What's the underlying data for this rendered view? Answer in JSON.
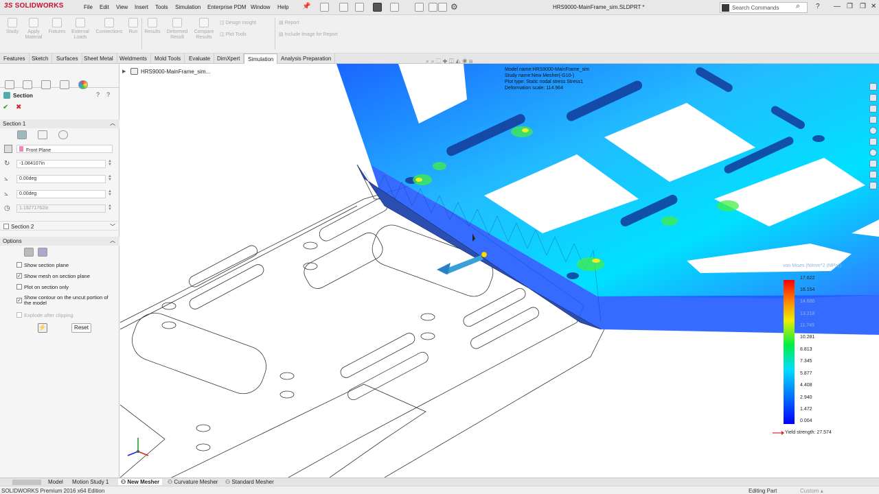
{
  "app": {
    "logo": "SOLIDWORKS",
    "logo_prefix": "3S",
    "document_title": "HRS9000-MainFrame_sim.SLDPRT *",
    "search_placeholder": "Search Commands",
    "menus": [
      "File",
      "Edit",
      "View",
      "Insert",
      "Tools",
      "Simulation",
      "Enterprise PDM",
      "Window",
      "Help"
    ]
  },
  "commands": {
    "main": [
      {
        "label": "Study",
        "icon": "study-icon"
      },
      {
        "label": "Apply Material",
        "icon": "material-icon"
      },
      {
        "label": "Fixtures",
        "icon": "fixtures-icon"
      },
      {
        "label": "External Loads",
        "icon": "loads-icon"
      },
      {
        "label": "Connections",
        "icon": "connections-icon"
      },
      {
        "label": "Run",
        "icon": "run-icon"
      },
      {
        "label": "Results",
        "icon": "results-icon"
      },
      {
        "label": "Deformed Result",
        "icon": "deformed-icon"
      },
      {
        "label": "Compare Results",
        "icon": "compare-icon"
      }
    ],
    "design_insight": "Design Insight",
    "plot_tools": "Plot Tools",
    "report": "Report",
    "include_image": "Include Image for Report"
  },
  "tabs": [
    "Features",
    "Sketch",
    "Surfaces",
    "Sheet Metal",
    "Weldments",
    "Mold Tools",
    "Evaluate",
    "DimXpert",
    "Simulation",
    "Analysis Preparation"
  ],
  "active_tab": "Simulation",
  "panel": {
    "title": "Section",
    "section1": "Section 1",
    "plane": "Front Plane",
    "offset": "-1.084107in",
    "angle1": "0.00deg",
    "angle2": "0.00deg",
    "radius": "1.19271762in",
    "section2": "Section 2",
    "options": "Options",
    "checks": [
      {
        "label": "Show section plane",
        "checked": false,
        "disabled": false
      },
      {
        "label": "Show mesh on section plane",
        "checked": true,
        "disabled": false
      },
      {
        "label": "Plot on section only",
        "checked": false,
        "disabled": false
      },
      {
        "label": "Show contour on the uncut portion of the model",
        "checked": true,
        "disabled": false
      },
      {
        "label": "Explode after clipping",
        "checked": false,
        "disabled": true
      }
    ],
    "reset": "Reset"
  },
  "tree": {
    "root": "HRS9000-MainFrame_sim..."
  },
  "plot_info": {
    "model_name": "Model name:HRS9000-MainFrame_sim",
    "study_name": "Study name:New Mesher(-G10-)",
    "plot_type": "Plot type: Static nodal stress Stress1",
    "deformation": "Deformation scale: 114.964"
  },
  "legend": {
    "title": "von Mises (N/mm^2 (MPa))",
    "values": [
      "17.622",
      "16.154",
      "14.686",
      "13.218",
      "11.749",
      "10.281",
      "8.813",
      "7.345",
      "5.877",
      "4.408",
      "2.940",
      "1.472",
      "0.004"
    ],
    "yield": "Yield strength: 27.574"
  },
  "bottom_tabs": [
    "Model",
    "Motion Study 1",
    "New Mesher",
    "Curvature Mesher",
    "Standard Mesher"
  ],
  "active_bottom_tab": "New Mesher",
  "status": {
    "edition": "SOLIDWORKS Premium 2016 x64 Edition",
    "mode": "Editing Part",
    "units": "Custom"
  },
  "colors": {
    "accent": "#c8102e",
    "stress_low": "#1a3cff",
    "stress_mid": "#00e5ff",
    "stress_high": "#ff1a00"
  }
}
